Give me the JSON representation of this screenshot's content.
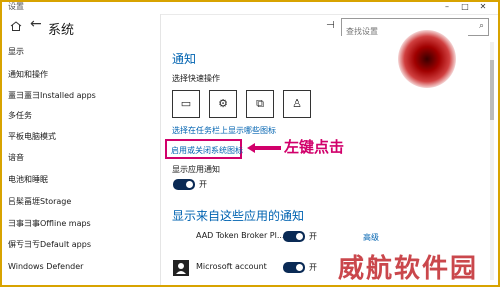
{
  "window": {
    "title": "设置"
  },
  "header": {
    "title": "系统",
    "search_placeholder": "查找设置"
  },
  "sidebar": {
    "items": [
      {
        "label": "显示"
      },
      {
        "label": "通知和操作"
      },
      {
        "label": "畺彐畺彐Installed apps"
      },
      {
        "label": "多任务"
      },
      {
        "label": "平板电脑模式"
      },
      {
        "label": "谙音"
      },
      {
        "label": "电池和睡眠"
      },
      {
        "label": "㠯髤畐堐Storage"
      },
      {
        "label": "彐事彐事Offline maps"
      },
      {
        "label": "偋亐彐亐Default apps"
      },
      {
        "label": "Windows Defender"
      }
    ]
  },
  "main": {
    "section_title": "通知",
    "quick_actions_label": "选择快速操作",
    "quick_actions": [
      {
        "icon": "tablet-mode-icon",
        "glyph": "▭"
      },
      {
        "icon": "settings-icon",
        "glyph": "⚙"
      },
      {
        "icon": "connect-icon",
        "glyph": "⧉"
      },
      {
        "icon": "location-icon",
        "glyph": "♙"
      }
    ],
    "link_taskbar_icons": "选择在任务栏上显示哪些图标",
    "link_system_icons": "启用或关闭系统图标",
    "show_app_notifications_label": "显示应用通知",
    "toggle_on_label": "开",
    "apps_section_title": "显示来自这些应用的通知",
    "apps": [
      {
        "name": "AAD Token Broker Pl...",
        "state": "开",
        "advanced": "高级"
      },
      {
        "name": "Microsoft account",
        "state": "开",
        "advanced": ""
      }
    ]
  },
  "annotation": {
    "text": "左键点击",
    "color": "#d1006b"
  },
  "watermark": {
    "text": "威航软件园"
  },
  "colors": {
    "accent": "#0063b1",
    "highlight": "#d1006b",
    "frame": "#d8a300"
  }
}
